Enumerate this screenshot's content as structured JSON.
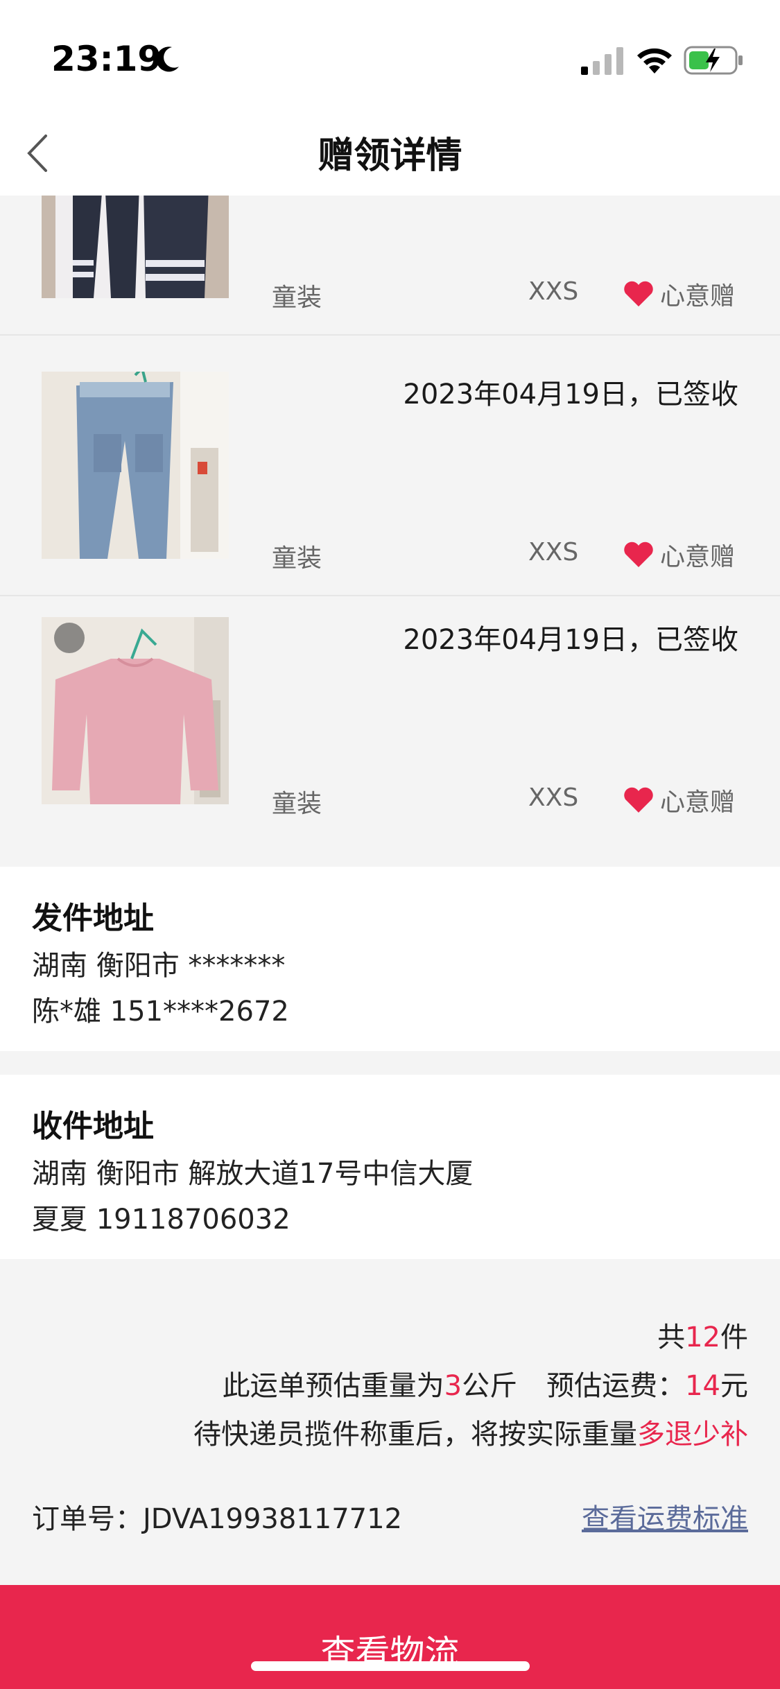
{
  "status": {
    "time": "23:19"
  },
  "nav": {
    "title": "赠领详情"
  },
  "items": [
    {
      "date": "",
      "category": "童装",
      "size": "XXS",
      "gift_label": "心意赠"
    },
    {
      "date": "2023年04月19日，已签收",
      "category": "童装",
      "size": "XXS",
      "gift_label": "心意赠"
    },
    {
      "date": "2023年04月19日，已签收",
      "category": "童装",
      "size": "XXS",
      "gift_label": "心意赠"
    }
  ],
  "sender": {
    "title": "发件地址",
    "address": "湖南 衡阳市 *******",
    "contact": "陈*雄 151****2672"
  },
  "receiver": {
    "title": "收件地址",
    "address": "湖南 衡阳市 解放大道17号中信大厦",
    "contact": "夏夏 19118706032"
  },
  "summary": {
    "total_prefix": "共",
    "total_count": "12",
    "total_suffix": "件",
    "weight_prefix": "此运单预估重量为",
    "weight_value": "3",
    "weight_unit": "公斤",
    "fee_prefix": "预估运费：",
    "fee_value": "14",
    "fee_unit": "元",
    "note_prefix": "待快递员揽件称重后，将按实际重量",
    "note_highlight": "多退少补",
    "order_label": "订单号：",
    "order_number": "JDVA19938117712",
    "fee_standard_link": "查看运费标准"
  },
  "bottom_button": "查看物流",
  "colors": {
    "accent": "#e8264d",
    "link": "#5b6b9a",
    "background": "#f4f4f4"
  }
}
